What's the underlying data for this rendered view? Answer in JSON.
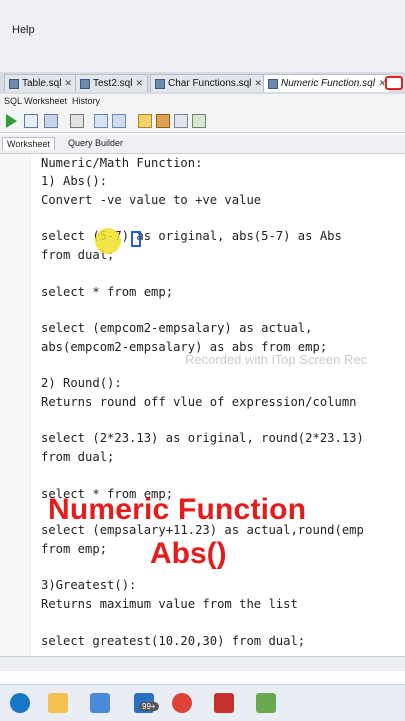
{
  "menu": {
    "help_label": "Help"
  },
  "tabs": [
    {
      "label": "Table.sql",
      "active": false
    },
    {
      "label": "Test2.sql",
      "active": false
    },
    {
      "label": "Char Functions.sql",
      "active": false
    },
    {
      "label": "Numeric Function.sql",
      "active": true
    }
  ],
  "subtabs": {
    "worksheet": "SQL Worksheet",
    "history": "History"
  },
  "editor_tabs": {
    "worksheet": "Worksheet",
    "query_builder": "Query Builder"
  },
  "code_lines": [
    "Numeric/Math Function:",
    "1) Abs():",
    "Convert -ve value to +ve value",
    "",
    "select (5-7) as original, abs(5-7) as Abs",
    "from dual;",
    "",
    "select * from emp;",
    "",
    "select (empcom2-empsalary) as actual,",
    "abs(empcom2-empsalary) as abs from emp;",
    "",
    "2) Round():",
    "Returns round off vlue of expression/column",
    "",
    "select (2*23.13) as original, round(2*23.13)",
    "from dual;",
    "",
    "select * from emp;",
    "select (empsalary+11.23) as actual,round(emp",
    "from emp;",
    "",
    "3)Greatest():",
    "Returns maximum value from the list",
    "",
    "select greatest(10.20,30) from dual;"
  ],
  "watermark": "Recorded with iTop Screen Rec",
  "overlay": {
    "line1": "Numeric Function",
    "line2": "Abs()"
  },
  "taskbar": {
    "badge": "99+"
  },
  "colors": {
    "accent_red": "#e51c1c",
    "keyword_blue": "#1d3fa6"
  }
}
